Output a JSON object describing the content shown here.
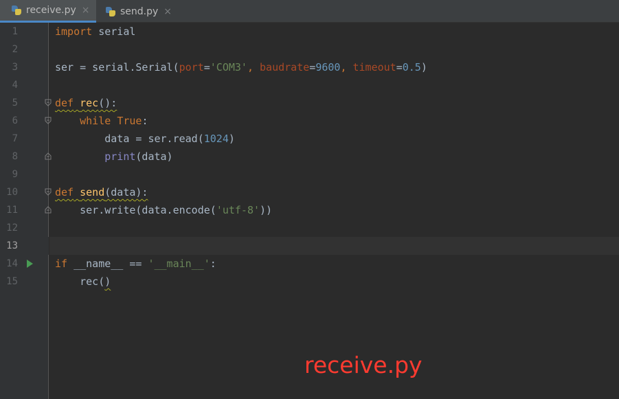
{
  "tabs": [
    {
      "label": "receive.py",
      "active": true
    },
    {
      "label": "send.py",
      "active": false
    }
  ],
  "close_glyph": "×",
  "line_numbers": [
    "1",
    "2",
    "3",
    "4",
    "5",
    "6",
    "7",
    "8",
    "9",
    "10",
    "11",
    "12",
    "13",
    "14",
    "15"
  ],
  "code": {
    "l1": {
      "kw": "import",
      "rest": " serial"
    },
    "l3": {
      "a": "ser = serial.Serial(",
      "p1": "port",
      "eq1": "=",
      "s1": "'COM3'",
      "c1": ", ",
      "p2": "baudrate",
      "eq2": "=",
      "n1": "9600",
      "c2": ", ",
      "p3": "timeout",
      "eq3": "=",
      "n2": "0.5",
      "end": ")"
    },
    "l5": {
      "kw": "def",
      "sp": " ",
      "fn": "rec",
      "rest": "():"
    },
    "l6": {
      "indent": "    ",
      "kw": "while",
      "sp": " ",
      "kw2": "True",
      "rest": ":"
    },
    "l7": {
      "a": "        data = ser.read(",
      "n": "1024",
      "end": ")"
    },
    "l8": {
      "indent": "        ",
      "bi": "print",
      "rest": "(data)"
    },
    "l10": {
      "kw": "def",
      "sp": " ",
      "fn": "send",
      "rest": "(data):"
    },
    "l11": {
      "a": "    ser.write(data.encode(",
      "s": "'utf-8'",
      "end": "))"
    },
    "l14": {
      "kw": "if",
      "a": " __name__ == ",
      "s": "'__main__'",
      "end": ":"
    },
    "l15": {
      "a": "    rec(",
      "end": ")"
    }
  },
  "current_line": "13",
  "caption": "receive.py",
  "colors": {
    "background": "#2b2b2b",
    "keyword": "#cc7832",
    "function": "#ffc66d",
    "string": "#6a8759",
    "number": "#6897bb",
    "parameter": "#aa4926",
    "caption": "#ff3b30"
  }
}
